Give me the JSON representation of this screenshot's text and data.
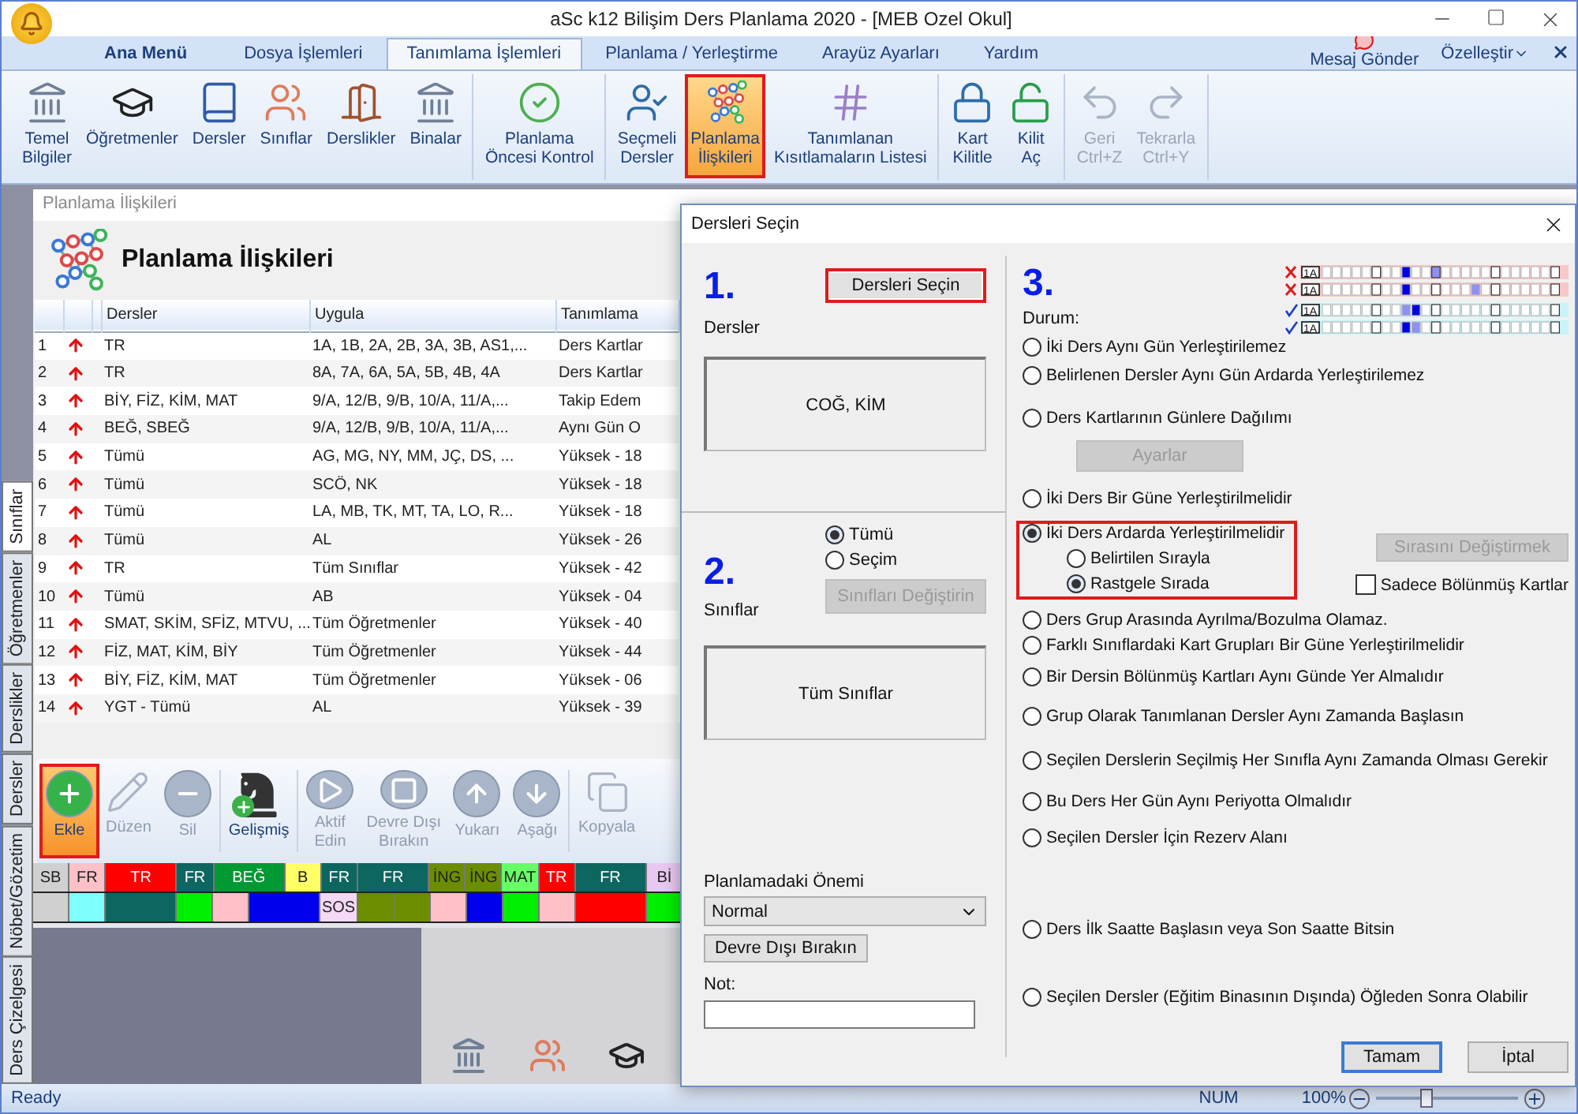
{
  "window": {
    "title": "aSc k12 Bilişim Ders Planlama 2020  - [MEB Ozel Okul]"
  },
  "menu_tabs": [
    {
      "label": "Ana Menü",
      "kind": "main",
      "selected": false
    },
    {
      "label": "Dosya İşlemleri",
      "kind": "tab",
      "selected": false
    },
    {
      "label": "Tanımlama İşlemleri",
      "kind": "tab",
      "selected": true
    },
    {
      "label": "Planlama / Yerleştirme",
      "kind": "tab",
      "selected": false
    },
    {
      "label": "Arayüz Ayarları",
      "kind": "tab",
      "selected": false
    },
    {
      "label": "Yardım",
      "kind": "tab",
      "selected": false
    }
  ],
  "menu_right": {
    "message": "Mesaj Gönder",
    "customize": "Özelleştir"
  },
  "ribbon": {
    "groups": [
      [
        {
          "label": "Temel\nBilgiler",
          "selected": false,
          "disabled": false,
          "highlighted": false
        },
        {
          "label": "Öğretmenler",
          "selected": false,
          "disabled": false,
          "highlighted": false
        },
        {
          "label": "Dersler",
          "selected": false,
          "disabled": false,
          "highlighted": false
        },
        {
          "label": "Sınıflar",
          "selected": false,
          "disabled": false,
          "highlighted": false
        },
        {
          "label": "Derslikler",
          "selected": false,
          "disabled": false,
          "highlighted": false
        },
        {
          "label": "Binalar",
          "selected": false,
          "disabled": false,
          "highlighted": false
        }
      ],
      [
        {
          "label": "Planlama\nÖncesi Kontrol",
          "selected": false,
          "disabled": false,
          "highlighted": false
        }
      ],
      [
        {
          "label": "Seçmeli\nDersler",
          "selected": false,
          "disabled": false,
          "highlighted": false
        },
        {
          "label": "Planlama\nİlişkileri",
          "selected": true,
          "disabled": false,
          "highlighted": true
        },
        {
          "label": "Tanımlanan\nKısıtlamaların Listesi",
          "selected": false,
          "disabled": false,
          "highlighted": false
        }
      ],
      [
        {
          "label": "Kart\nKilitle",
          "selected": false,
          "disabled": false,
          "highlighted": false
        },
        {
          "label": "Kilit\nAç",
          "selected": false,
          "disabled": false,
          "highlighted": false
        }
      ],
      [
        {
          "label": "Geri\nCtrl+Z",
          "selected": false,
          "disabled": true,
          "highlighted": false
        },
        {
          "label": "Tekrarla\nCtrl+Y",
          "selected": false,
          "disabled": true,
          "highlighted": false
        }
      ]
    ]
  },
  "side_tabs": [
    {
      "label": "Sınıflar",
      "selected": true
    },
    {
      "label": "Öğretmenler",
      "selected": false
    },
    {
      "label": "Derslikler",
      "selected": false
    },
    {
      "label": "Dersler",
      "selected": false
    },
    {
      "label": "Nöbet/Gözetim",
      "selected": false
    },
    {
      "label": "Ders Çizelgesi",
      "selected": false
    }
  ],
  "panel": {
    "title": "Planlama İlişkileri",
    "heading": "Planlama İlişkileri",
    "columns": [
      "Dersler",
      "Uygula",
      "Tanımlama"
    ],
    "rows": [
      {
        "no": "1",
        "dersler": "TR",
        "uygula": "1A, 1B, 2A, 2B, 3A, 3B, AS1,...",
        "tanimlama": "Ders Kartlar"
      },
      {
        "no": "2",
        "dersler": "TR",
        "uygula": "8A, 7A, 6A, 5A, 5B, 4B, 4A",
        "tanimlama": "Ders Kartlar"
      },
      {
        "no": "3",
        "dersler": "BİY, FİZ, KİM, MAT",
        "uygula": "9/A, 12/B, 9/B, 10/A, 11/A,...",
        "tanimlama": "Takip Edem"
      },
      {
        "no": "4",
        "dersler": "BEĞ, SBEĞ",
        "uygula": "9/A, 12/B, 9/B, 10/A, 11/A,...",
        "tanimlama": "Aynı Gün O"
      },
      {
        "no": "5",
        "dersler": "Tümü",
        "uygula": "AG, MG, NY, MM, JÇ, DS, ...",
        "tanimlama": "Yüksek - 18"
      },
      {
        "no": "6",
        "dersler": "Tümü",
        "uygula": "SCÖ, NK",
        "tanimlama": "Yüksek - 18"
      },
      {
        "no": "7",
        "dersler": "Tümü",
        "uygula": "LA, MB, TK, MT, TA, LO, R...",
        "tanimlama": "Yüksek - 18"
      },
      {
        "no": "8",
        "dersler": "Tümü",
        "uygula": "AL",
        "tanimlama": "Yüksek - 26"
      },
      {
        "no": "9",
        "dersler": "TR",
        "uygula": "Tüm Sınıflar",
        "tanimlama": "Yüksek - 42"
      },
      {
        "no": "10",
        "dersler": "Tümü",
        "uygula": "AB",
        "tanimlama": "Yüksek - 04"
      },
      {
        "no": "11",
        "dersler": "SMAT, SKİM, SFİZ, MTVU, ...",
        "uygula": "Tüm Öğretmenler",
        "tanimlama": "Yüksek - 40"
      },
      {
        "no": "12",
        "dersler": "FİZ, MAT, KİM, BİY",
        "uygula": "Tüm Öğretmenler",
        "tanimlama": "Yüksek - 44"
      },
      {
        "no": "13",
        "dersler": "BİY, FİZ, KİM, MAT",
        "uygula": "Tüm Öğretmenler",
        "tanimlama": "Yüksek - 06"
      },
      {
        "no": "14",
        "dersler": "YGT - Tümü",
        "uygula": "AL",
        "tanimlama": "Yüksek - 39"
      }
    ]
  },
  "toolbar": [
    {
      "label": "Ekle",
      "disabled": false,
      "highlighted": true
    },
    {
      "label": "Düzen",
      "disabled": true,
      "highlighted": false
    },
    {
      "label": "Sil",
      "disabled": true,
      "highlighted": false
    },
    {
      "label": "Gelişmiş",
      "disabled": false,
      "highlighted": false
    },
    {
      "label": "Aktif\nEdin",
      "disabled": true,
      "highlighted": false
    },
    {
      "label": "Devre Dışı\nBırakın",
      "disabled": true,
      "highlighted": false
    },
    {
      "label": "Yukarı",
      "disabled": true,
      "highlighted": false
    },
    {
      "label": "Aşağı",
      "disabled": true,
      "highlighted": false
    },
    {
      "label": "Kopyala",
      "disabled": true,
      "highlighted": false
    }
  ],
  "timetable": [
    [
      {
        "text": "SB",
        "color": "#d0d0d0",
        "wide": false
      },
      {
        "text": "FR",
        "color": "#ffc0c8",
        "wide": false
      },
      {
        "text": "TR",
        "color": "#ff0000",
        "wide": true
      },
      {
        "text": "FR",
        "color": "#0d6660",
        "wide": false
      },
      {
        "text": "BEĞ",
        "color": "#009933",
        "wide": true
      },
      {
        "text": "B",
        "color": "#ffff66",
        "wide": false
      },
      {
        "text": "FR",
        "color": "#0d6660",
        "wide": false
      },
      {
        "text": "FR",
        "color": "#0d6660",
        "wide": true
      },
      {
        "text": "İNG",
        "color": "#6b8e00",
        "wide": false
      },
      {
        "text": "İNG",
        "color": "#6b8e00",
        "wide": false
      },
      {
        "text": "MAT",
        "color": "#66ff66",
        "wide": false
      },
      {
        "text": "TR",
        "color": "#ff0000",
        "wide": false
      },
      {
        "text": "FR",
        "color": "#0d6660",
        "wide": true
      },
      {
        "text": "Bİ",
        "color": "#e8c8f0",
        "wide": false
      }
    ],
    [
      {
        "color": "#d0d0d0",
        "wide": false
      },
      {
        "color": "#80ffff",
        "wide": false
      },
      {
        "color": "#0d6660",
        "wide": true
      },
      {
        "color": "#00ee00",
        "wide": false
      },
      {
        "color": "#ffc0c8",
        "wide": false
      },
      {
        "color": "#0000ee",
        "wide": true
      },
      {
        "text": "SOS",
        "color": "#f4d8f4",
        "wide": false
      },
      {
        "color": "#6b8e00",
        "wide": false
      },
      {
        "color": "#6b8e00",
        "wide": false
      },
      {
        "color": "#ffc0c8",
        "wide": false
      },
      {
        "color": "#0000ee",
        "wide": false
      },
      {
        "color": "#00ee00",
        "wide": false
      },
      {
        "color": "#ffc0c8",
        "wide": false
      },
      {
        "color": "#ff0000",
        "wide": true
      },
      {
        "color": "#00ee00",
        "wide": false
      }
    ]
  ],
  "dialog": {
    "title": "Dersleri Seçin",
    "step1": {
      "number": "1.",
      "label": "Dersler",
      "button": {
        "label": "Dersleri Seçin",
        "highlighted": true
      },
      "value": "COĞ, KİM"
    },
    "step2": {
      "number": "2.",
      "label": "Sınıflar",
      "radios": [
        {
          "label": "Tümü",
          "selected": true
        },
        {
          "label": "Seçim",
          "selected": false
        }
      ],
      "button": {
        "label": "Sınıfları Değiştirin",
        "disabled": true
      },
      "value": "Tüm Sınıflar"
    },
    "importance": {
      "label": "Planlamadaki Önemi",
      "value": "Normal"
    },
    "disable_button": "Devre Dışı Bırakın",
    "note": {
      "label": "Not:"
    },
    "step3": {
      "number": "3.",
      "label": "Durum:"
    },
    "example_rows": [
      {
        "valid": false,
        "label": "1A"
      },
      {
        "valid": false,
        "label": "1A"
      },
      {
        "valid": true,
        "label": "1A"
      },
      {
        "valid": true,
        "label": "1A"
      }
    ],
    "options": [
      {
        "label": "İki Ders Aynı Gün Yerleştirilemez",
        "selected": false
      },
      {
        "label": "Belirlenen Dersler Aynı Gün Ardarda Yerleştirilemez",
        "selected": false
      },
      {
        "label": "Ders Kartlarının Günlere Dağılımı",
        "selected": false,
        "button": {
          "label": "Ayarlar",
          "disabled": true
        }
      },
      {
        "label": "İki Ders Bir Güne Yerleştirilmelidir",
        "selected": false
      },
      {
        "label": "İki Ders Ardarda Yerleştirilmelidir",
        "selected": true,
        "highlighted": true,
        "children": [
          {
            "label": "Belirtilen Sırayla",
            "selected": false
          },
          {
            "label": "Rastgele Sırada",
            "selected": true
          }
        ],
        "button": {
          "label": "Sırasını Değiştirmek",
          "disabled": true
        },
        "checkbox": {
          "label": "Sadece Bölünmüş Kartlar",
          "checked": false
        }
      },
      {
        "label": "Ders Grup Arasında Ayrılma/Bozulma Olamaz.",
        "selected": false
      },
      {
        "label": "Farklı Sınıflardaki Kart Grupları Bir Güne Yerleştirilmelidir",
        "selected": false
      },
      {
        "label": "Bir Dersin Bölünmüş Kartları Aynı Günde Yer Almalıdır",
        "selected": false
      },
      {
        "label": "Grup Olarak Tanımlanan Dersler Aynı Zamanda Başlasın",
        "selected": false
      },
      {
        "label": "Seçilen Derslerin Seçilmiş Her Sınıfla Aynı Zamanda Olması Gerekir",
        "selected": false
      },
      {
        "label": "Bu Ders Her Gün Aynı Periyotta Olmalıdır",
        "selected": false
      },
      {
        "label": "Seçilen Dersler İçin Rezerv Alanı",
        "selected": false
      },
      {
        "label": "Ders İlk Saatte Başlasın veya Son Saatte Bitsin",
        "selected": false
      },
      {
        "label": "Seçilen Dersler (Eğitim Binasının Dışında) Öğleden Sonra Olabilir",
        "selected": false
      }
    ],
    "buttons": [
      {
        "label": "Tamam",
        "default": true
      },
      {
        "label": "İptal",
        "default": false
      }
    ]
  },
  "status_bar": {
    "text": "Ready",
    "num": "NUM",
    "zoom": "100%",
    "level": 0.35
  }
}
